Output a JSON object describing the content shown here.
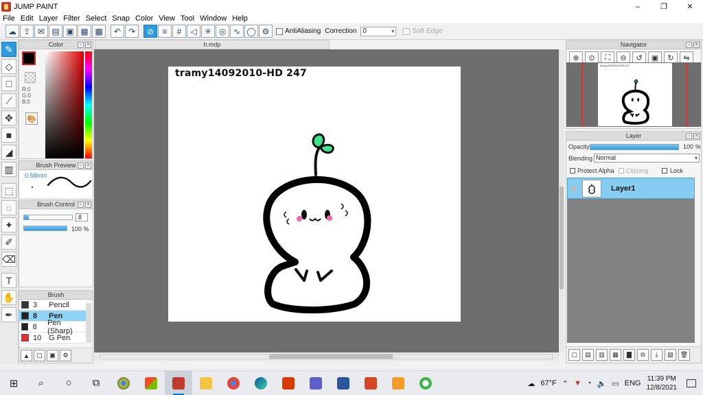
{
  "window": {
    "title": "JUMP PAINT",
    "minimize": "–",
    "maximize": "❐",
    "close": "✕"
  },
  "menu": [
    "File",
    "Edit",
    "Layer",
    "Filter",
    "Select",
    "Snap",
    "Color",
    "View",
    "Tool",
    "Window",
    "Help"
  ],
  "toolbar": {
    "antialiasing_label": "AntiAliasing",
    "correction_label": "Correction",
    "correction_value": "0",
    "soft_edge_label": "Soft Edge"
  },
  "color_panel": {
    "title": "Color",
    "rgb": {
      "r": "R:0",
      "g": "G:0",
      "b": "B:0"
    },
    "fg_color": "#000000"
  },
  "brush_preview": {
    "title": "Brush Preview",
    "size": "0.58mm"
  },
  "brush_control": {
    "title": "Brush Control",
    "size_value": "8",
    "opacity_value": "100 %",
    "size_fraction": 0.1,
    "opacity_fraction": 1.0
  },
  "brush_panel": {
    "title": "Brush",
    "items": [
      {
        "num": "3",
        "name": "Pencil",
        "color": "#333333"
      },
      {
        "num": "8",
        "name": "Pen",
        "color": "#222222",
        "selected": true
      },
      {
        "num": "8",
        "name": "Pen (Sharp)",
        "color": "#222222"
      },
      {
        "num": "10",
        "name": "G Pen",
        "color": "#e03030"
      }
    ]
  },
  "document": {
    "tab_title": "h.mdp",
    "canvas_text": "tramy14092010-HD 247"
  },
  "navigator": {
    "title": "Navigator",
    "thumb_text": "tramy14092010-HD 247"
  },
  "layer_panel": {
    "title": "Layer",
    "opacity_label": "Opacity",
    "opacity_value": "100 %",
    "blending_label": "Blending",
    "blending_value": "Normal",
    "protect_alpha_label": "Protect Alpha",
    "clipping_label": "Clipping",
    "lock_label": "Lock",
    "layers": [
      {
        "name": "Layer1"
      }
    ]
  },
  "taskbar": {
    "weather": "67°F",
    "language": "ENG",
    "time": "11:39 PM",
    "date": "12/8/2021"
  }
}
